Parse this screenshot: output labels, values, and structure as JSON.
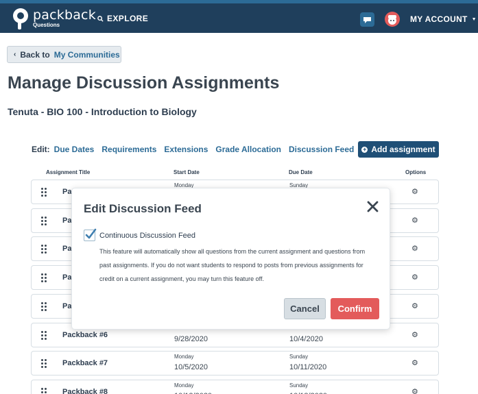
{
  "nav": {
    "brand": "packback",
    "brand_sub": "Questions",
    "explore": "EXPLORE",
    "account": "MY ACCOUNT"
  },
  "header": {
    "back_prefix": "Back to",
    "back_link": "My Communities",
    "title": "Manage Discussion Assignments",
    "course": "Tenuta - BIO 100 - Introduction to Biology"
  },
  "edit": {
    "label": "Edit:",
    "links": [
      "Due Dates",
      "Requirements",
      "Extensions",
      "Grade Allocation",
      "Discussion Feed"
    ],
    "add_button": "Add assignment"
  },
  "table": {
    "columns": [
      "Assignment Title",
      "Start Date",
      "Due Date",
      "Options"
    ],
    "rows": [
      {
        "title": "Pa",
        "start_day": "Monday",
        "start_date": "",
        "due_day": "Sunday",
        "due_date": ""
      },
      {
        "title": "Pa",
        "start_day": "",
        "start_date": "",
        "due_day": "",
        "due_date": ""
      },
      {
        "title": "Pa",
        "start_day": "",
        "start_date": "",
        "due_day": "",
        "due_date": ""
      },
      {
        "title": "Pa",
        "start_day": "",
        "start_date": "",
        "due_day": "",
        "due_date": ""
      },
      {
        "title": "Pa",
        "start_day": "",
        "start_date": "",
        "due_day": "",
        "due_date": ""
      },
      {
        "title": "Packback #6",
        "start_day": "",
        "start_date": "9/28/2020",
        "due_day": "",
        "due_date": "10/4/2020"
      },
      {
        "title": "Packback #7",
        "start_day": "Monday",
        "start_date": "10/5/2020",
        "due_day": "Sunday",
        "due_date": "10/11/2020"
      },
      {
        "title": "Packback #8",
        "start_day": "Monday",
        "start_date": "10/12/2020",
        "due_day": "Sunday",
        "due_date": "10/18/2020"
      }
    ]
  },
  "modal": {
    "title": "Edit Discussion Feed",
    "checkbox_label": "Continuous Discussion Feed",
    "checked": true,
    "description": "This feature will automatically show all questions from the current assignment and questions from past assignments. If you do not want students to respond to posts from previous assignments for credit on a current assignment, you may turn this feature off.",
    "cancel": "Cancel",
    "confirm": "Confirm"
  },
  "colors": {
    "nav_bg": "#1f3f5c",
    "link": "#2c6b96",
    "primary_button": "#1f4f76",
    "confirm": "#e35b5b",
    "check": "#3f7fb0"
  },
  "icons": [
    "packback-logo-icon",
    "search-icon",
    "notification-icon",
    "user-avatar-icon",
    "caret-down-icon",
    "chevron-left-icon",
    "plus-circle-icon",
    "drag-handle-icon",
    "gear-icon",
    "close-icon",
    "checkmark-icon"
  ]
}
